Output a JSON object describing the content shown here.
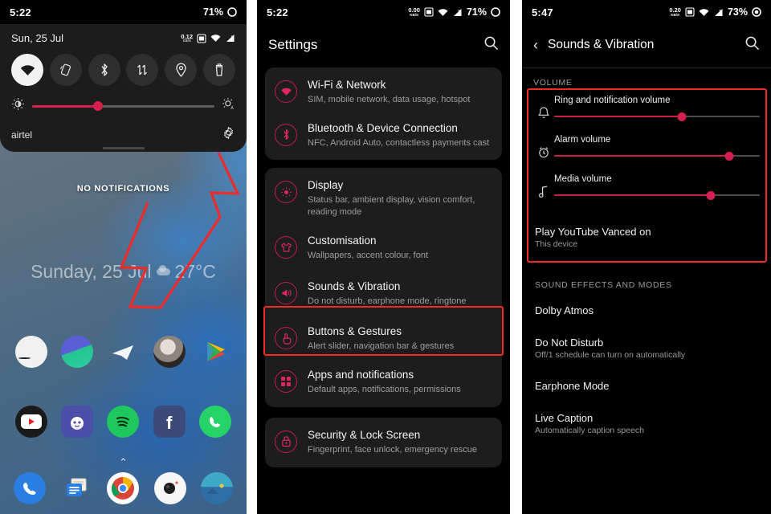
{
  "panel1": {
    "status": {
      "time": "5:22",
      "battery": "71%",
      "battery_icon": "battery-circle-icon"
    },
    "quick_settings": {
      "date": "Sun, 25 Jul",
      "status_icons": [
        "data-rate-icon",
        "sim-icon",
        "wifi-icon",
        "signal-icon"
      ],
      "data_rate_value": "0.12",
      "data_rate_unit": "KB/S",
      "toggles": [
        {
          "name": "wifi-toggle",
          "icon": "wifi-icon",
          "active": true
        },
        {
          "name": "auto-rotate-toggle",
          "icon": "auto-rotate-icon",
          "active": false
        },
        {
          "name": "bluetooth-toggle",
          "icon": "bluetooth-icon",
          "active": false
        },
        {
          "name": "mobile-data-toggle",
          "icon": "data-transfer-icon",
          "active": false
        },
        {
          "name": "location-toggle",
          "icon": "location-pin-icon",
          "active": false
        },
        {
          "name": "flashlight-toggle",
          "icon": "flashlight-icon",
          "active": false
        }
      ],
      "brightness_percent": 36,
      "brightness_low_icon": "brightness-low-icon",
      "brightness_auto_icon": "brightness-auto-icon",
      "carrier": "airtel",
      "settings_gear": "gear-icon"
    },
    "home": {
      "no_notifications": "NO NOTIFICATIONS",
      "clock_widget": "Sunday, 25 Jul",
      "weather_temp": "27°C",
      "weather_icon": "cloud-icon",
      "row1_apps": [
        "folder-icon",
        "photos-icon",
        "telegram-icon",
        "contact-avatar-icon",
        "play-store-icon"
      ],
      "row2_apps": [
        "youtube-icon",
        "reddit-icon",
        "spotify-icon",
        "facebook-icon",
        "whatsapp-icon"
      ],
      "dock_apps": [
        "phone-icon",
        "messages-icon",
        "chrome-icon",
        "camera-icon",
        "gallery-icon"
      ],
      "page_arrow": "chevron-up-icon"
    },
    "annotation": {
      "shape": "hand-drawn-arrow",
      "color": "#ee2b2b",
      "points_to": "gear-icon"
    }
  },
  "panel2": {
    "status": {
      "time": "5:22",
      "battery": "71%",
      "data_rate_value": "0.00",
      "data_rate_unit": "KB/S"
    },
    "header": {
      "title": "Settings",
      "search_icon": "search-icon"
    },
    "groups": [
      {
        "items": [
          {
            "icon": "wifi-icon",
            "title": "Wi-Fi & Network",
            "subtitle": "SIM, mobile network, data usage, hotspot",
            "highlighted": false
          },
          {
            "icon": "bluetooth-icon",
            "title": "Bluetooth & Device Connection",
            "subtitle": "NFC, Android Auto, contactless payments cast",
            "highlighted": false
          }
        ]
      },
      {
        "items": [
          {
            "icon": "display-brightness-icon",
            "title": "Display",
            "subtitle": "Status bar, ambient display, vision comfort, reading mode",
            "highlighted": false
          },
          {
            "icon": "tshirt-icon",
            "title": "Customisation",
            "subtitle": "Wallpapers, accent colour, font",
            "highlighted": false
          },
          {
            "icon": "speaker-icon",
            "title": "Sounds & Vibration",
            "subtitle": "Do not disturb, earphone mode, ringtone",
            "highlighted": true
          },
          {
            "icon": "buttons-gestures-icon",
            "title": "Buttons & Gestures",
            "subtitle": "Alert slider, navigation bar & gestures",
            "highlighted": false
          },
          {
            "icon": "apps-grid-icon",
            "title": "Apps and notifications",
            "subtitle": "Default apps, notifications, permissions",
            "highlighted": false
          }
        ]
      },
      {
        "items": [
          {
            "icon": "lock-icon",
            "title": "Security & Lock Screen",
            "subtitle": "Fingerprint, face unlock, emergency rescue",
            "highlighted": false
          }
        ]
      }
    ]
  },
  "panel3": {
    "status": {
      "time": "5:47",
      "battery": "73%",
      "data_rate_value": "0.20",
      "data_rate_unit": "KB/S"
    },
    "header": {
      "back_icon": "back-chevron-icon",
      "title": "Sounds & Vibration",
      "search_icon": "search-icon"
    },
    "volume_section": {
      "label": "VOLUME",
      "highlighted": true,
      "sliders": [
        {
          "icon": "bell-icon",
          "label": "Ring and notification volume",
          "value": 62
        },
        {
          "icon": "alarm-clock-icon",
          "label": "Alarm volume",
          "value": 85
        },
        {
          "icon": "music-note-icon",
          "label": "Media volume",
          "value": 76
        }
      ]
    },
    "play_row": {
      "title": "Play YouTube Vanced on",
      "subtitle": "This device"
    },
    "effects_label": "SOUND EFFECTS AND MODES",
    "effects_rows": [
      {
        "title": "Dolby Atmos",
        "subtitle": ""
      },
      {
        "title": "Do Not Disturb",
        "subtitle": "Off/1 schedule can turn on automatically"
      },
      {
        "title": "Earphone Mode",
        "subtitle": ""
      },
      {
        "title": "Live Caption",
        "subtitle": "Automatically caption speech"
      }
    ]
  },
  "colors": {
    "accent_pink": "#d4204a",
    "icon_pink": "#e0285f",
    "highlight_red": "#ee2b2b",
    "card_bg": "#1d1d1d",
    "panel_bg": "#000000"
  }
}
